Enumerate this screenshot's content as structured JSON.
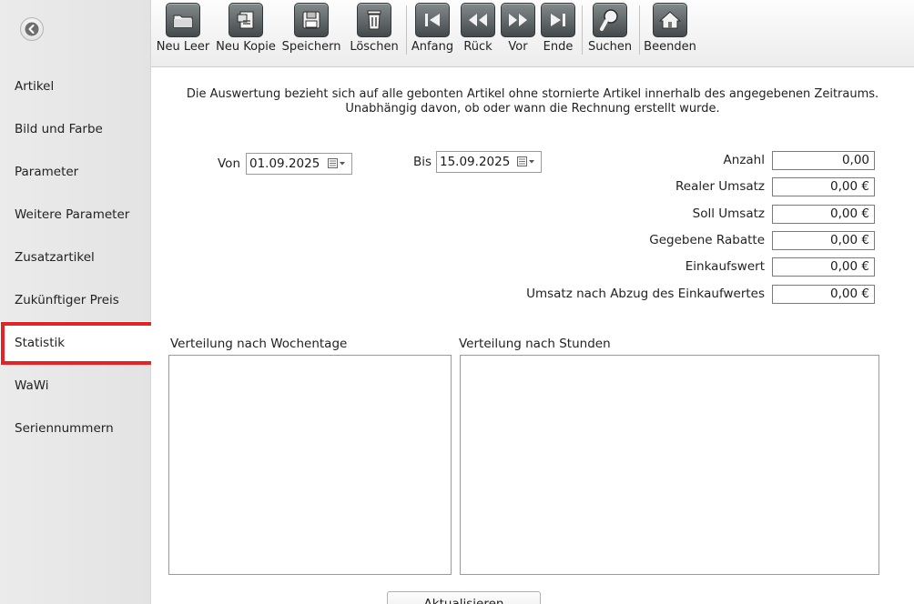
{
  "sidebar": {
    "items": [
      {
        "label": "Artikel"
      },
      {
        "label": "Bild und Farbe"
      },
      {
        "label": "Parameter"
      },
      {
        "label": "Weitere Parameter"
      },
      {
        "label": "Zusatzartikel"
      },
      {
        "label": "Zukünftiger Preis"
      },
      {
        "label": "Statistik",
        "active": true
      },
      {
        "label": "WaWi"
      },
      {
        "label": "Seriennummern"
      }
    ]
  },
  "toolbar": {
    "neu_leer": "Neu Leer",
    "neu_kopie": "Neu Kopie",
    "speichern": "Speichern",
    "loeschen": "Löschen",
    "anfang": "Anfang",
    "rueck": "Rück",
    "vor": "Vor",
    "ende": "Ende",
    "suchen": "Suchen",
    "beenden": "Beenden"
  },
  "main": {
    "description_line1": "Die Auswertung bezieht sich auf alle gebonten Artikel ohne stornierte Artikel innerhalb des angegebenen Zeitraums.",
    "description_line2": "Unabhängig davon, ob oder wann die Rechnung erstellt wurde.",
    "von_label": "Von",
    "von_value": "01.09.2025",
    "bis_label": "Bis",
    "bis_value": "15.09.2025",
    "stats": {
      "anzahl_label": "Anzahl",
      "anzahl_value": "0,00",
      "realer_umsatz_label": "Realer Umsatz",
      "realer_umsatz_value": "0,00 €",
      "soll_umsatz_label": "Soll Umsatz",
      "soll_umsatz_value": "0,00 €",
      "rabatte_label": "Gegebene Rabatte",
      "rabatte_value": "0,00 €",
      "einkaufswert_label": "Einkaufswert",
      "einkaufswert_value": "0,00 €",
      "umsatz_netto_label": "Umsatz nach Abzug des Einkaufwertes",
      "umsatz_netto_value": "0,00 €"
    },
    "wochentage_title": "Verteilung nach Wochentage",
    "stunden_title": "Verteilung nach Stunden",
    "refresh_label": "Aktualisieren"
  },
  "colors": {
    "active_highlight": "#e42326",
    "toolbar_icon": "#5a6163"
  }
}
